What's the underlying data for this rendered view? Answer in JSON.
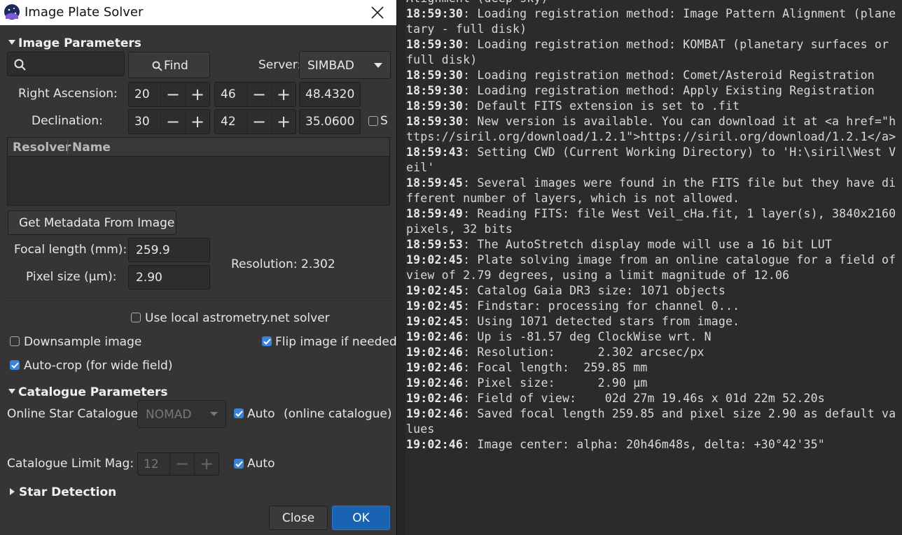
{
  "window": {
    "title": "Image Plate Solver"
  },
  "image_params": {
    "header": "Image Parameters",
    "search_value": "",
    "find_label": "Find",
    "server_label": "Server:",
    "server_value": "SIMBAD",
    "ra_label": "Right Ascension:",
    "ra_h": "20",
    "ra_m": "46",
    "ra_s": "48.4320",
    "dec_label": "Declination:",
    "dec_d": "30",
    "dec_m": "42",
    "dec_s": "35.0600",
    "south_label": "S",
    "south_checked": false,
    "table_headers": [
      "Resolver",
      "Name"
    ],
    "metadata_button": "Get Metadata From Image",
    "focal_label": "Focal length (mm):",
    "focal_value": "259.9",
    "pixel_label": "Pixel size (µm):",
    "pixel_value": "2.90",
    "resolution_label": "Resolution:",
    "resolution_value": "2.302",
    "local_solver_label": "Use local astrometry.net solver",
    "local_solver_checked": false,
    "downsample_label": "Downsample image",
    "downsample_checked": false,
    "flip_label": "Flip image if needed",
    "flip_checked": true,
    "autocrop_label": "Auto-crop (for wide field)",
    "autocrop_checked": true
  },
  "catalogue_params": {
    "header": "Catalogue Parameters",
    "online_label": "Online Star Catalogue:",
    "online_value": "NOMAD",
    "auto_label": "Auto",
    "auto_checked": true,
    "online_note": "(online catalogue)",
    "limit_label": "Catalogue Limit Mag:",
    "limit_value": "12",
    "limit_auto_label": "Auto",
    "limit_auto_checked": true
  },
  "star_detection": {
    "header": "Star Detection"
  },
  "buttons": {
    "close": "Close",
    "ok": "OK"
  },
  "log": [
    {
      "ts": "",
      "msg": "Alignment (deep-sky)"
    },
    {
      "ts": "18:59:30",
      "msg": ": Loading registration method: Image Pattern Alignment (planetary - full disk)"
    },
    {
      "ts": "18:59:30",
      "msg": ": Loading registration method: KOMBAT (planetary surfaces or full disk)"
    },
    {
      "ts": "18:59:30",
      "msg": ": Loading registration method: Comet/Asteroid Registration"
    },
    {
      "ts": "18:59:30",
      "msg": ": Loading registration method: Apply Existing Registration"
    },
    {
      "ts": "18:59:30",
      "msg": ": Default FITS extension is set to .fit"
    },
    {
      "ts": "18:59:30",
      "msg": ": New version is available. You can download it at <a href=\"https://siril.org/download/1.2.1\">https://siril.org/download/1.2.1</a>"
    },
    {
      "ts": "18:59:43",
      "msg": ": Setting CWD (Current Working Directory) to 'H:\\siril\\West Veil'"
    },
    {
      "ts": "18:59:45",
      "msg": ": Several images were found in the FITS file but they have different number of layers, which is not allowed."
    },
    {
      "ts": "18:59:49",
      "msg": ": Reading FITS: file West Veil_cHa.fit, 1 layer(s), 3840x2160 pixels, 32 bits"
    },
    {
      "ts": "18:59:53",
      "msg": ": The AutoStretch display mode will use a 16 bit LUT"
    },
    {
      "ts": "19:02:45",
      "msg": ": Plate solving image from an online catalogue for a field of view of 2.79 degrees, using a limit magnitude of 12.06"
    },
    {
      "ts": "19:02:45",
      "msg": ": Catalog Gaia DR3 size: 1071 objects"
    },
    {
      "ts": "19:02:45",
      "msg": ": Findstar: processing for channel 0..."
    },
    {
      "ts": "19:02:45",
      "msg": ": Using 1071 detected stars from image."
    },
    {
      "ts": "19:02:46",
      "msg": ": Up is -81.57 deg ClockWise wrt. N"
    },
    {
      "ts": "19:02:46",
      "msg": ": Resolution:      2.302 arcsec/px"
    },
    {
      "ts": "19:02:46",
      "msg": ": Focal length:  259.85 mm"
    },
    {
      "ts": "19:02:46",
      "msg": ": Pixel size:      2.90 µm"
    },
    {
      "ts": "19:02:46",
      "msg": ": Field of view:    02d 27m 19.46s x 01d 22m 52.20s"
    },
    {
      "ts": "19:02:46",
      "msg": ": Saved focal length 259.85 and pixel size 2.90 as default values"
    },
    {
      "ts": "19:02:46",
      "msg": ": Image center: alpha: 20h46m48s, delta: +30°42'35\""
    }
  ]
}
